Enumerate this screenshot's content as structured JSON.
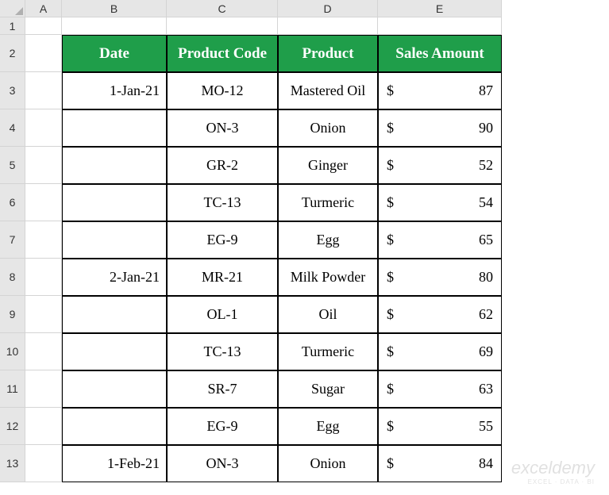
{
  "columns": [
    "",
    "A",
    "B",
    "C",
    "D",
    "E"
  ],
  "rows": [
    "1",
    "2",
    "3",
    "4",
    "5",
    "6",
    "7",
    "8",
    "9",
    "10",
    "11",
    "12",
    "13"
  ],
  "table": {
    "headers": [
      "Date",
      "Product Code",
      "Product",
      "Sales Amount"
    ],
    "data": [
      {
        "date": "1-Jan-21",
        "code": "MO-12",
        "product": "Mastered Oil",
        "currency": "$",
        "amount": "87"
      },
      {
        "date": "",
        "code": "ON-3",
        "product": "Onion",
        "currency": "$",
        "amount": "90"
      },
      {
        "date": "",
        "code": "GR-2",
        "product": "Ginger",
        "currency": "$",
        "amount": "52"
      },
      {
        "date": "",
        "code": "TC-13",
        "product": "Turmeric",
        "currency": "$",
        "amount": "54"
      },
      {
        "date": "",
        "code": "EG-9",
        "product": "Egg",
        "currency": "$",
        "amount": "65"
      },
      {
        "date": "2-Jan-21",
        "code": "MR-21",
        "product": "Milk Powder",
        "currency": "$",
        "amount": "80"
      },
      {
        "date": "",
        "code": "OL-1",
        "product": "Oil",
        "currency": "$",
        "amount": "62"
      },
      {
        "date": "",
        "code": "TC-13",
        "product": "Turmeric",
        "currency": "$",
        "amount": "69"
      },
      {
        "date": "",
        "code": "SR-7",
        "product": "Sugar",
        "currency": "$",
        "amount": "63"
      },
      {
        "date": "",
        "code": "EG-9",
        "product": "Egg",
        "currency": "$",
        "amount": "55"
      },
      {
        "date": "1-Feb-21",
        "code": "ON-3",
        "product": "Onion",
        "currency": "$",
        "amount": "84"
      }
    ]
  },
  "watermark": {
    "main": "exceldemy",
    "sub": "EXCEL · DATA · BI"
  }
}
